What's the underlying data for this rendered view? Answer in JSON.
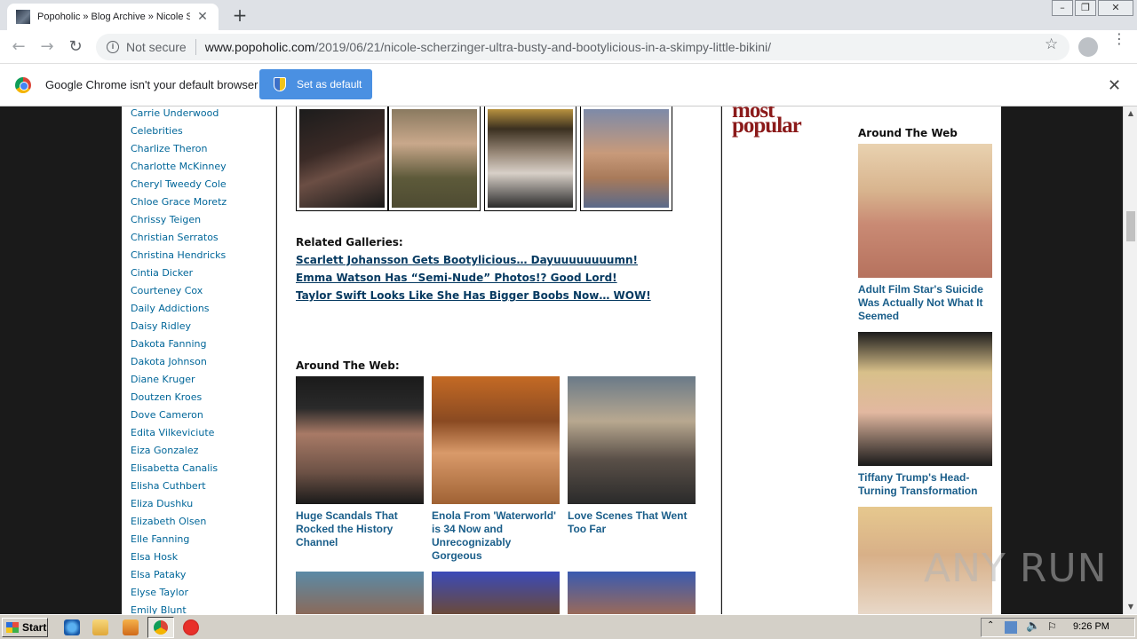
{
  "browser": {
    "tab_title": "Popoholic » Blog Archive » Nicole Sch",
    "not_secure": "Not secure",
    "url_domain": "www.popoholic.com",
    "url_path": "/2019/06/21/nicole-scherzinger-ultra-busty-and-bootylicious-in-a-skimpy-little-bikini/",
    "infobar_text": "Google Chrome isn't your default browser",
    "set_default_label": "Set as default"
  },
  "sidebar": {
    "items": [
      "Carrie Underwood",
      "Celebrities",
      "Charlize Theron",
      "Charlotte McKinney",
      "Cheryl Tweedy Cole",
      "Chloe Grace Moretz",
      "Chrissy Teigen",
      "Christian Serratos",
      "Christina Hendricks",
      "Cintia Dicker",
      "Courteney Cox",
      "Daily Addictions",
      "Daisy Ridley",
      "Dakota Fanning",
      "Dakota Johnson",
      "Diane Kruger",
      "Doutzen Kroes",
      "Dove Cameron",
      "Edita Vilkeviciute",
      "Eiza Gonzalez",
      "Elisabetta Canalis",
      "Elisha Cuthbert",
      "Eliza Dushku",
      "Elizabeth Olsen",
      "Elle Fanning",
      "Elsa Hosk",
      "Elsa Pataky",
      "Elyse Taylor",
      "Emily Blunt"
    ]
  },
  "main": {
    "related_title": "Related Galleries:",
    "related_links": [
      "Scarlett Johansson Gets Bootylicious… Dayuuuuuuuumn!",
      "Emma Watson Has “Semi-Nude” Photos!? Good Lord!",
      "Taylor Swift Looks Like She Has Bigger Boobs Now… WOW!"
    ],
    "around_title": "Around The Web:",
    "around_items": [
      "Huge Scandals That Rocked the History Channel",
      "Enola From 'Waterworld' is 34 Now and Unrecognizably Gorgeous",
      "Love Scenes That Went Too Far"
    ]
  },
  "right": {
    "most_popular_1": "most",
    "most_popular_2": "popular",
    "around_title": "Around The Web",
    "items": [
      "Adult Film Star's Suicide Was Actually Not What It Seemed",
      "Tiffany Trump's Head-Turning Transformation"
    ]
  },
  "watermark": "ANY RUN",
  "taskbar": {
    "start_label": "Start",
    "clock": "9:26 PM"
  }
}
